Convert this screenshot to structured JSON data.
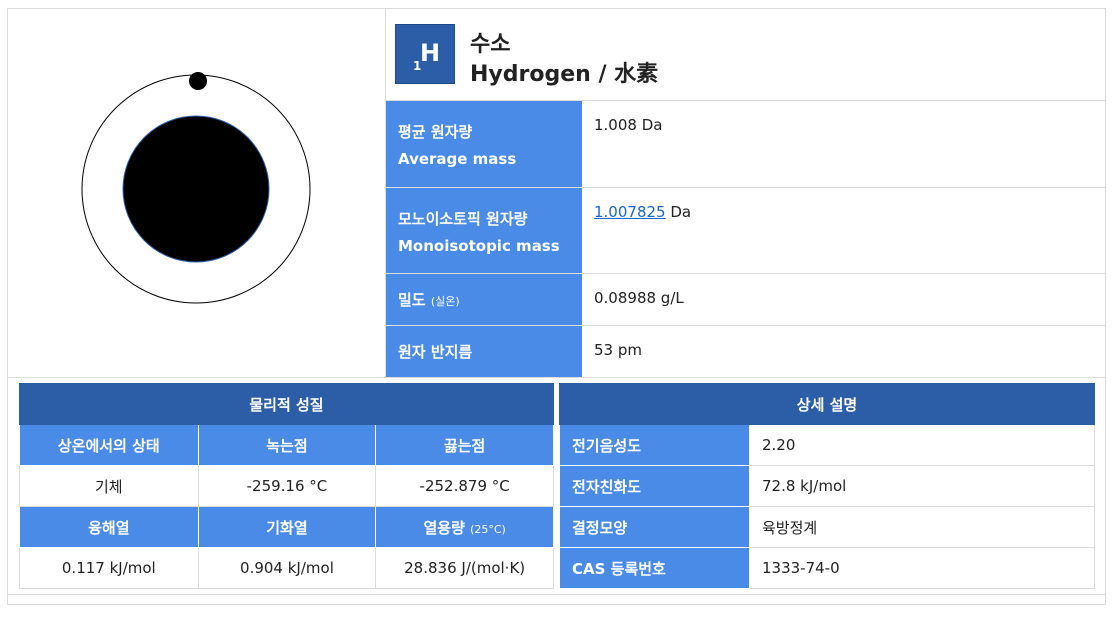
{
  "element": {
    "atomic_number": "1",
    "symbol": "H",
    "name_ko": "수소",
    "name_en": "Hydrogen / 水素"
  },
  "properties": [
    {
      "label_ko": "평균 원자량",
      "label_en": "Average mass",
      "value": "1.008 Da"
    },
    {
      "label_ko": "모노이소토픽 원자량",
      "label_en": "Monoisotopic mass",
      "value_link": "1.007825",
      "value_unit": "Da"
    },
    {
      "label_ko": "밀도",
      "label_note": "(실온)",
      "value": "0.08988 g/L"
    },
    {
      "label_ko": "원자 반지름",
      "value": "53 pm"
    }
  ],
  "physical": {
    "caption": "물리적 성질",
    "headers1": [
      "상온에서의 상태",
      "녹는점",
      "끓는점"
    ],
    "values1": [
      "기체",
      "-259.16 °C",
      "-252.879 °C"
    ],
    "headers2": [
      "융해열",
      "기화열",
      "열용량"
    ],
    "header2_note": "(25°C)",
    "values2": [
      "0.117 kJ/mol",
      "0.904 kJ/mol",
      "28.836 J/(mol·K)"
    ]
  },
  "details": {
    "caption": "상세 설명",
    "rows": [
      {
        "label": "전기음성도",
        "value": "2.20"
      },
      {
        "label": "전자친화도",
        "value": "72.8 kJ/mol"
      },
      {
        "label": "결정모양",
        "value": "육방정계"
      },
      {
        "label": "CAS 등록번호",
        "value": "1333-74-0"
      }
    ]
  },
  "colors": {
    "primary": "#2c5ea8",
    "accent": "#4a8be8",
    "link": "#1a66c8"
  }
}
